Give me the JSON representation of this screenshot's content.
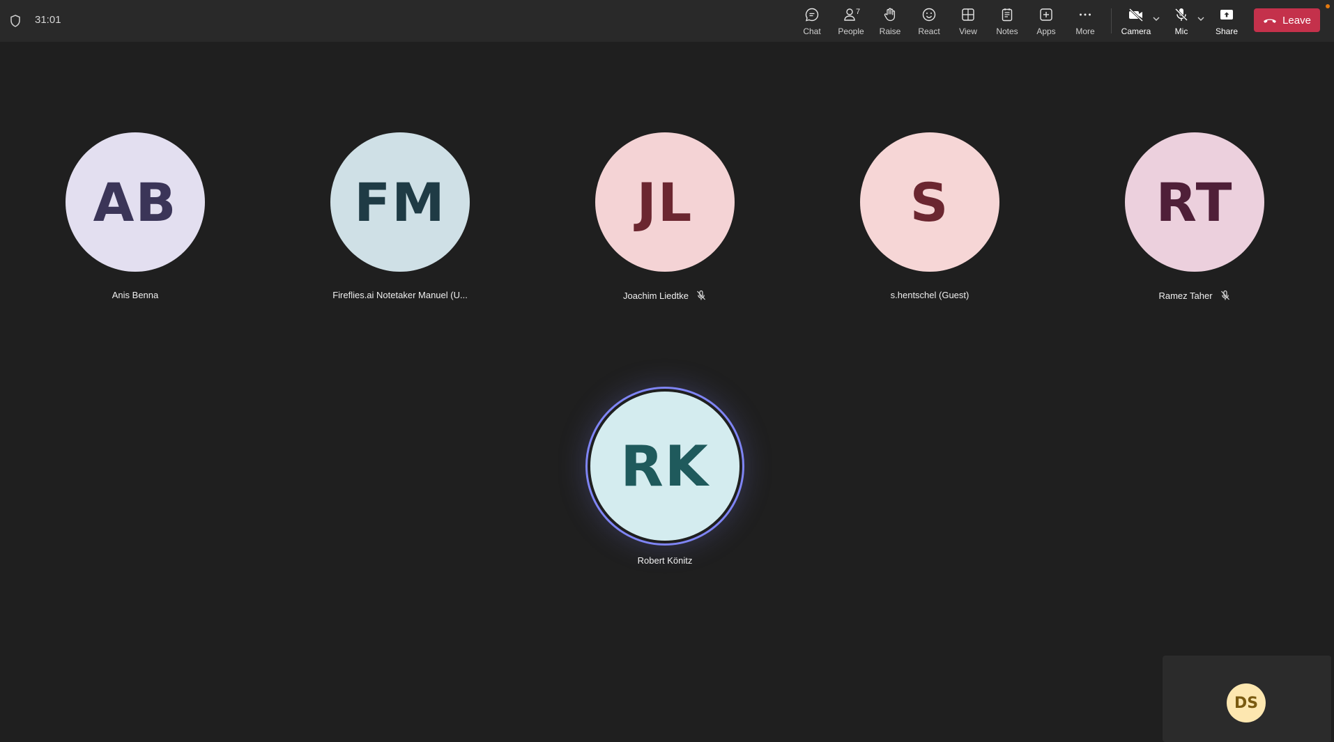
{
  "call": {
    "timer": "31:01"
  },
  "toolbar": {
    "chat": "Chat",
    "people": "People",
    "people_count": "7",
    "raise": "Raise",
    "react": "React",
    "view": "View",
    "notes": "Notes",
    "apps": "Apps",
    "more": "More",
    "camera": "Camera",
    "mic": "Mic",
    "share": "Share",
    "leave": "Leave"
  },
  "participants": [
    {
      "initials": "AB",
      "name": "Anis Benna",
      "bg": "#e3dff0",
      "fg": "#3b3558",
      "muted": false
    },
    {
      "initials": "FM",
      "name": "Fireflies.ai Notetaker Manuel (U...",
      "bg": "#cfe0e6",
      "fg": "#1f3b45",
      "muted": false
    },
    {
      "initials": "JL",
      "name": "Joachim Liedtke",
      "bg": "#f4d3d5",
      "fg": "#6b2630",
      "muted": true
    },
    {
      "initials": "S",
      "name": "s.hentschel (Guest)",
      "bg": "#f6d6d6",
      "fg": "#6b2630",
      "muted": false
    },
    {
      "initials": "RT",
      "name": "Ramez Taher",
      "bg": "#ecd0dd",
      "fg": "#4f1f38",
      "muted": true
    }
  ],
  "active_speaker": {
    "initials": "RK",
    "name": "Robert Könitz",
    "bg": "#d4ecef",
    "fg": "#1f5a5c"
  },
  "self_view": {
    "initials": "DS"
  },
  "colors": {
    "accent_ring": "#7f85f5",
    "leave": "#c4314b",
    "background": "#1f1f1f",
    "topbar": "#292929"
  }
}
